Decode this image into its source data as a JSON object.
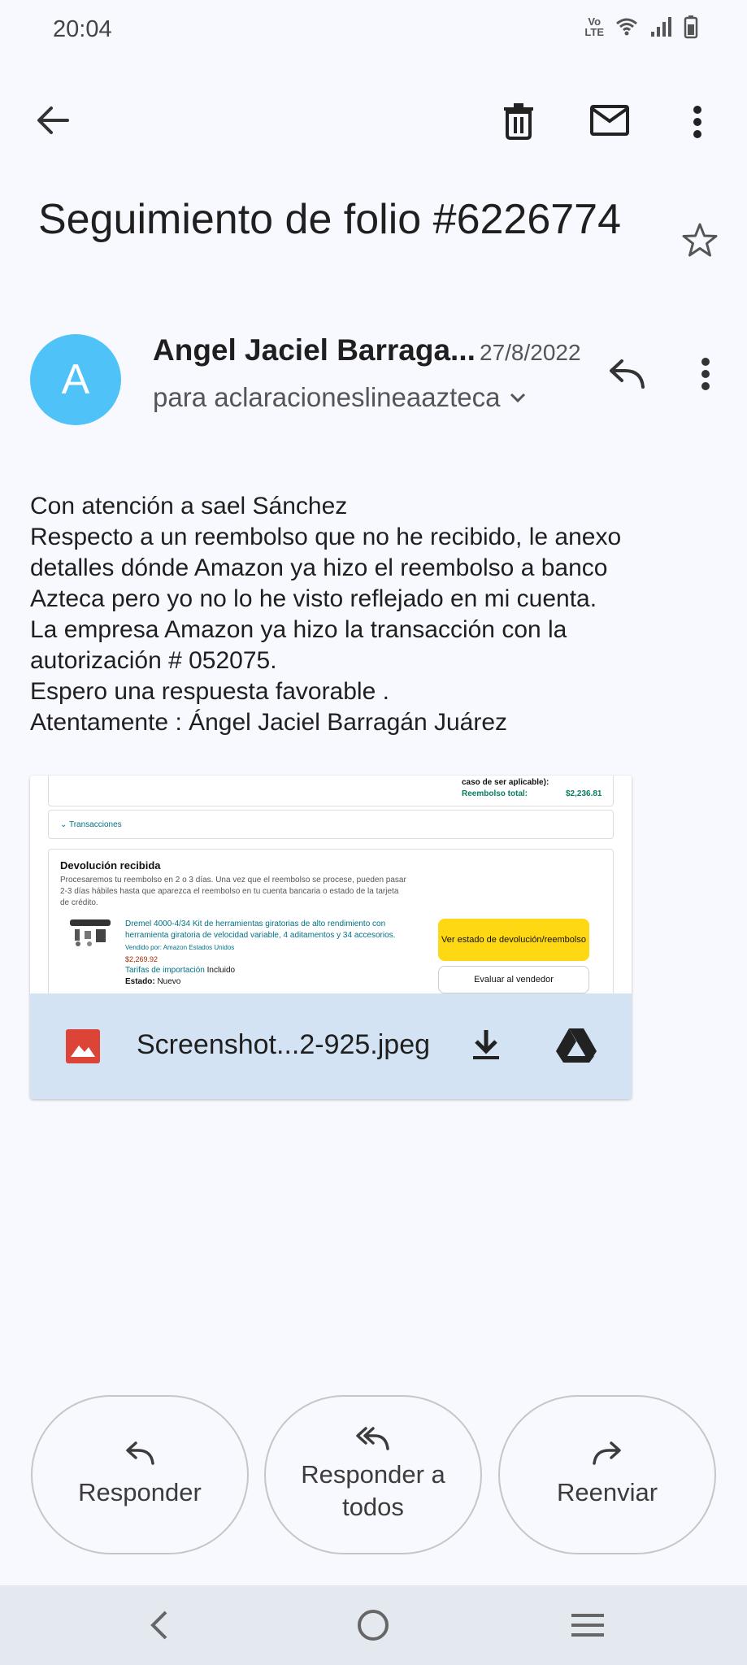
{
  "status_bar": {
    "time": "20:04",
    "volte_line1": "Vo",
    "volte_line2": "LTE",
    "icons": [
      "volte-icon",
      "wifi-icon",
      "signal-icon",
      "battery-icon"
    ]
  },
  "toolbar": {
    "icons": [
      "back-arrow-icon",
      "trash-icon",
      "mail-icon",
      "more-vert-icon"
    ]
  },
  "email": {
    "subject": "Seguimiento de folio #6226774",
    "sender": {
      "initial": "A",
      "name": "Angel Jaciel Barraga...",
      "date": "27/8/2022",
      "recipient": "para aclaracioneslineaazteca",
      "avatar_color": "#4fc3f7"
    },
    "body_lines": [
      "Con atención a sael Sánchez",
      "Respecto a un reembolso que no he recibido, le anexo",
      "detalles dónde Amazon ya hizo el reembolso a banco",
      "Azteca pero yo no lo he visto reflejado en mi cuenta.",
      "La empresa Amazon ya hizo la transacción con la",
      "autorización # 052075.",
      "Espero una respuesta favorable .",
      "Atentamente : Ángel Jaciel Barragán Juárez"
    ],
    "attachment": {
      "filename": "Screenshot...2-925.jpeg",
      "bar_color": "#d3e3f3",
      "preview": {
        "case_text": "caso de ser aplicable):",
        "refund_label": "Reembolso total:",
        "refund_value": "$2,236.81",
        "transactions_link": "Transacciones",
        "return_title": "Devolución recibida",
        "return_desc_1": "Procesaremos tu reembolso en 2 o 3 días. Una vez que el reembolso se procese, pueden pasar",
        "return_desc_2": "2-3 días hábiles hasta que aparezca el reembolso en tu cuenta bancaria o estado de la tarjeta",
        "return_desc_3": "de crédito.",
        "product_line_1": "Dremel 4000-4/34 Kit de herramientas giratorias de alto rendimiento con",
        "product_line_2": "herramienta giratoria de velocidad variable, 4 aditamentos y 34 accesorios.",
        "seller": "Vendido por: Amazon Estados Unidos",
        "price": "$2,269.92",
        "import_fees_label": "Tarifas de importación",
        "import_fees_value": "Incluido",
        "state_label": "Estado:",
        "state_value": "Nuevo",
        "btn_status": "Ver estado de devolución/reembolso",
        "btn_rate": "Evaluar al vendedor"
      }
    }
  },
  "actions": {
    "reply": "Responder",
    "reply_all": "Responder a todos",
    "forward": "Reenviar"
  },
  "nav_bar": {
    "icons": [
      "nav-back-icon",
      "nav-home-icon",
      "nav-recents-icon"
    ],
    "background": "#e4e9f0"
  }
}
